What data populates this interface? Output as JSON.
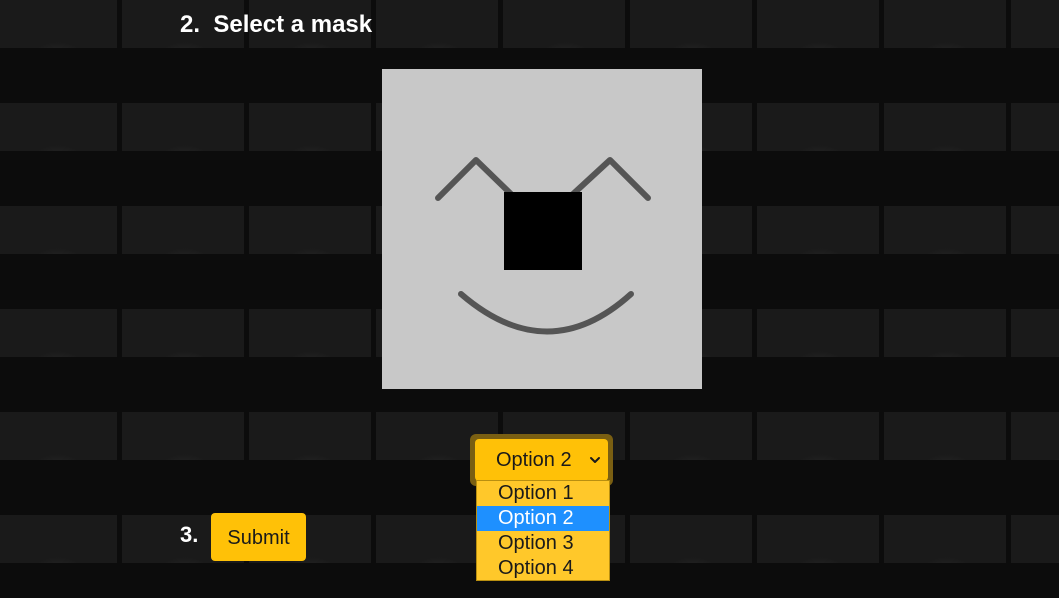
{
  "step2": {
    "title": "2.  Select a mask"
  },
  "mask": {
    "label": "smiling face mask"
  },
  "step3": {
    "number": "3."
  },
  "submit": {
    "label": "Submit"
  },
  "select": {
    "value": "Option 2",
    "options": [
      "Option 1",
      "Option 2",
      "Option 3",
      "Option 4"
    ],
    "highlighted": "Option 2"
  },
  "colors": {
    "accent": "#ffc107",
    "selected_option": "#1e90ff",
    "mask_background": "#c8c8c8"
  },
  "icons": {
    "chevron": "chevron-down-icon"
  }
}
